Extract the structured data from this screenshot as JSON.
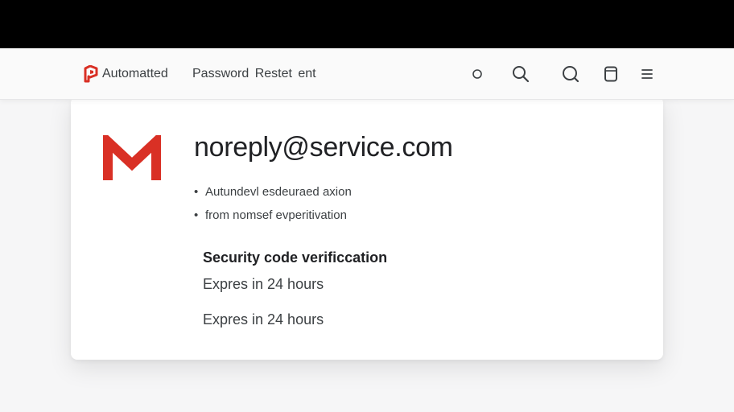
{
  "toolbar": {
    "brand": "Automatted",
    "title": "Password Restet ent",
    "icons": [
      "circle-icon",
      "search-icon",
      "search-icon",
      "tablet-icon",
      "menu-icon"
    ]
  },
  "email": {
    "sender": "noreply@service.com",
    "bullets": [
      "Autundevl esdeuraed axion",
      "from nomsef evperitivation"
    ],
    "section_title": "Security code verificcation",
    "expiry_lines": [
      "Expres in 24 hours",
      "Expres in 24 hours"
    ]
  },
  "colors": {
    "brand_red": "#d93025",
    "top_bar": "#000000",
    "card": "#ffffff"
  }
}
